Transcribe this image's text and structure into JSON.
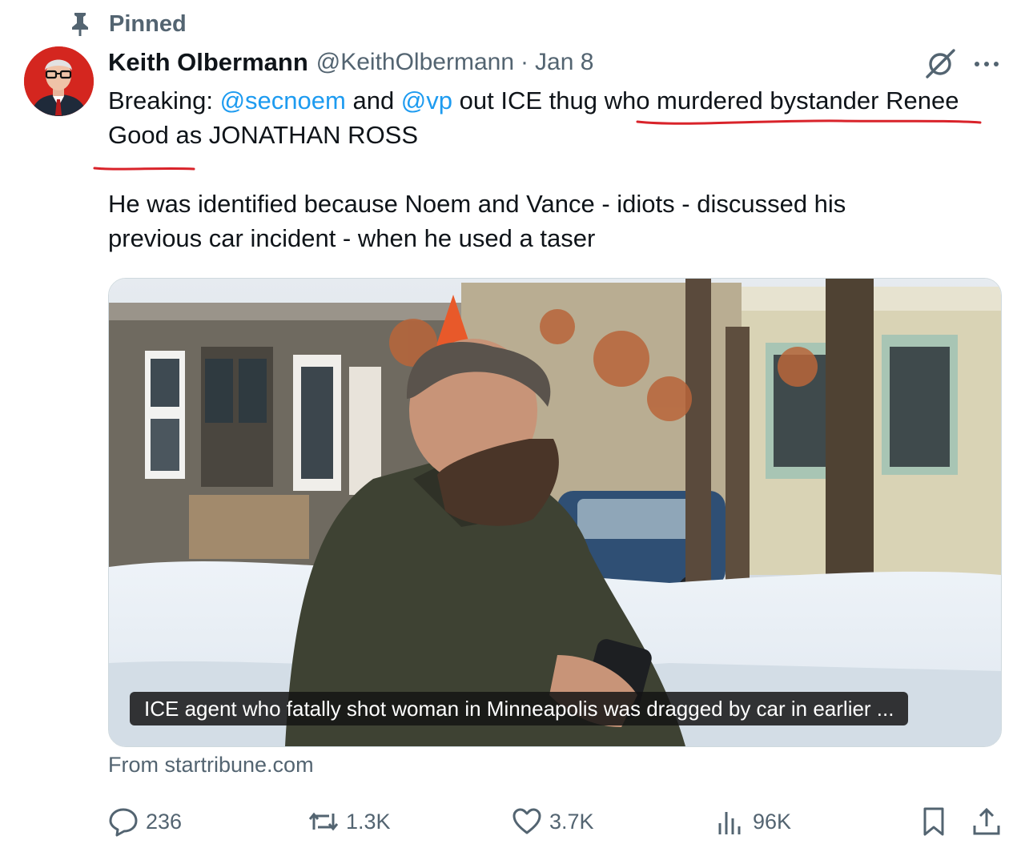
{
  "pinned_label": "Pinned",
  "author": {
    "name": "Keith Olbermann",
    "handle": "@KeithOlbermann",
    "separator": "·",
    "date": "Jan 8"
  },
  "tweet": {
    "l1_a": "Breaking: ",
    "l1_m1": "@secnoem",
    "l1_b": " and ",
    "l1_m2": "@vp",
    "l1_c": " out ICE thug who murdered bystander Renee",
    "l2": "Good as JONATHAN ROSS",
    "l3": "He was identified because Noem and Vance - idiots - discussed his",
    "l4": "previous car incident - when he used a taser"
  },
  "media": {
    "caption": "ICE agent who fatally shot woman in Minneapolis was dragged by car in earlier ...",
    "source": "From startribune.com"
  },
  "stats": {
    "replies": "236",
    "reposts": "1.3K",
    "likes": "3.7K",
    "views": "96K"
  },
  "icons": [
    "pin-icon",
    "grok-icon",
    "more-icon",
    "reply-icon",
    "repost-icon",
    "like-icon",
    "views-icon",
    "bookmark-icon",
    "share-icon"
  ],
  "colors": {
    "link": "#1d9bf0",
    "secondary_text": "#536471",
    "annotation": "#d9232a"
  }
}
